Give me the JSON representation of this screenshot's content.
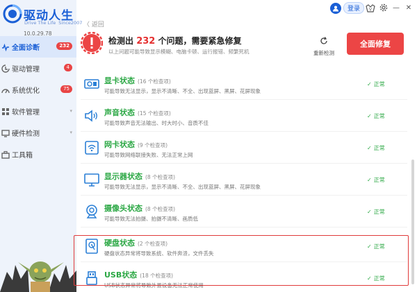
{
  "app": {
    "title": "驱动人生",
    "subtitle_a": "Drive The Life",
    "subtitle_b": "Since2007",
    "version": "10.0.29.78"
  },
  "sidebar": {
    "items": [
      {
        "label": "全面诊断",
        "badge": "232",
        "icon": "stethoscope-icon",
        "active": true
      },
      {
        "label": "驱动管理",
        "badge": "4",
        "icon": "driver-icon"
      },
      {
        "label": "系统优化",
        "badge": "75",
        "icon": "optimize-icon"
      },
      {
        "label": "软件管理",
        "arrow": "▾",
        "icon": "software-icon"
      },
      {
        "label": "硬件检测",
        "arrow": "▾",
        "icon": "hardware-icon"
      },
      {
        "label": "工具箱",
        "icon": "toolbox-icon"
      }
    ]
  },
  "topbar": {
    "login": "登录",
    "vip": "V",
    "gear_icon": "gear-icon",
    "minimize": "—",
    "close": "✕"
  },
  "nav": {
    "back": "〈 返回"
  },
  "header": {
    "title_pre": "检测出",
    "count": "232",
    "title_post": "个问题，需要紧急修复",
    "subtitle": "以上问题可能导致显示模糊、电脑卡顿、运行报错、频繁死机",
    "rescan": "重新检测",
    "fix": "全面修复"
  },
  "rows": [
    {
      "title": "显卡状态",
      "count": "(16 个检查项)",
      "desc": "可能导致无法显示，显示不清晰、不全、出现蓝屏、黑屏、花屏现象",
      "status": "正常",
      "icon": "gpu-icon"
    },
    {
      "title": "声音状态",
      "count": "(15 个检查项)",
      "desc": "可能导致声音无法输出、时大时小、音质不佳",
      "status": "正常",
      "icon": "speaker-icon"
    },
    {
      "title": "网卡状态",
      "count": "(9 个检查项)",
      "desc": "可能导致网络联接失败、无法正常上网",
      "status": "正常",
      "icon": "wifi-icon"
    },
    {
      "title": "显示器状态",
      "count": "(8 个检查项)",
      "desc": "可能导致无法显示，显示不清晰、不全、出现蓝屏、黑屏、花屏现象",
      "status": "正常",
      "icon": "monitor-icon"
    },
    {
      "title": "摄像头状态",
      "count": "(8 个检查项)",
      "desc": "可能导致无法拍摄、拍摄不清晰、画质低",
      "status": "正常",
      "icon": "webcam-icon"
    },
    {
      "title": "硬盘状态",
      "count": "(2 个检查项)",
      "desc": "硬盘状态异常将导致系统、软件奔溃，文件丢失",
      "status": "正常",
      "icon": "harddisk-icon"
    },
    {
      "title": "USB状态",
      "count": "(18 个检查项)",
      "desc": "USB状态异常将导致外置设备无法正常使用",
      "status": "正常",
      "icon": "usb-icon"
    }
  ],
  "colors": {
    "accent": "#1a5fd6",
    "ok": "#2ca845",
    "danger": "#e53030"
  }
}
